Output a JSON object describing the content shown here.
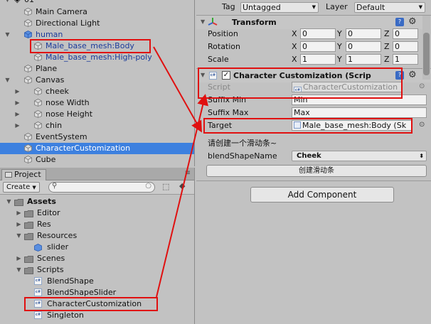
{
  "hierarchy": {
    "partial_label": "01",
    "rows": [
      {
        "label": "Main Camera",
        "indent": 1,
        "expand": "",
        "selected": false,
        "blue": false
      },
      {
        "label": "Directional Light",
        "indent": 1,
        "expand": "",
        "selected": false,
        "blue": false
      },
      {
        "label": "human",
        "indent": 1,
        "expand": "down",
        "selected": false,
        "blue": true
      },
      {
        "label": "Male_base_mesh:Body",
        "indent": 2,
        "expand": "",
        "selected": false,
        "blue": true
      },
      {
        "label": "Male_base_mesh:High-poly",
        "indent": 2,
        "expand": "",
        "selected": false,
        "blue": true
      },
      {
        "label": "Plane",
        "indent": 1,
        "expand": "",
        "selected": false,
        "blue": false
      },
      {
        "label": "Canvas",
        "indent": 1,
        "expand": "down",
        "selected": false,
        "blue": false
      },
      {
        "label": "cheek",
        "indent": 2,
        "expand": "right",
        "selected": false,
        "blue": false
      },
      {
        "label": "nose Width",
        "indent": 2,
        "expand": "right",
        "selected": false,
        "blue": false
      },
      {
        "label": "nose Height",
        "indent": 2,
        "expand": "right",
        "selected": false,
        "blue": false
      },
      {
        "label": "chin",
        "indent": 2,
        "expand": "right",
        "selected": false,
        "blue": false
      },
      {
        "label": "EventSystem",
        "indent": 1,
        "expand": "",
        "selected": false,
        "blue": false
      },
      {
        "label": "CharacterCustomization",
        "indent": 1,
        "expand": "",
        "selected": true,
        "blue": false
      },
      {
        "label": "Cube",
        "indent": 1,
        "expand": "",
        "selected": false,
        "blue": false
      }
    ]
  },
  "project": {
    "tab_label": "Project",
    "create_label": "Create",
    "rows": [
      {
        "label": "Assets",
        "type": "folder",
        "indent": 0,
        "expand": "down",
        "bold": true
      },
      {
        "label": "Editor",
        "type": "folder",
        "indent": 1,
        "expand": "right",
        "bold": false
      },
      {
        "label": "Res",
        "type": "folder",
        "indent": 1,
        "expand": "right",
        "bold": false
      },
      {
        "label": "Resources",
        "type": "folder",
        "indent": 1,
        "expand": "down",
        "bold": false
      },
      {
        "label": "slider",
        "type": "prefab",
        "indent": 2,
        "expand": "",
        "bold": false
      },
      {
        "label": "Scenes",
        "type": "folder",
        "indent": 1,
        "expand": "right",
        "bold": false
      },
      {
        "label": "Scripts",
        "type": "folder",
        "indent": 1,
        "expand": "down",
        "bold": false
      },
      {
        "label": "BlendShape",
        "type": "script",
        "indent": 2,
        "expand": "",
        "bold": false
      },
      {
        "label": "BlendShapeSlider",
        "type": "script",
        "indent": 2,
        "expand": "",
        "bold": false
      },
      {
        "label": "CharacterCustomization",
        "type": "script",
        "indent": 2,
        "expand": "",
        "bold": false
      },
      {
        "label": "Singleton",
        "type": "script",
        "indent": 2,
        "expand": "",
        "bold": false
      }
    ]
  },
  "inspector": {
    "tag_label": "Tag",
    "tag_value": "Untagged",
    "layer_label": "Layer",
    "layer_value": "Default",
    "transform": {
      "title": "Transform",
      "position_label": "Position",
      "rotation_label": "Rotation",
      "scale_label": "Scale",
      "x": "X",
      "y": "Y",
      "z": "Z",
      "position": [
        "0",
        "0",
        "0"
      ],
      "rotation": [
        "0",
        "0",
        "0"
      ],
      "scale": [
        "1",
        "1",
        "1"
      ]
    },
    "component": {
      "title": "Character Customization (Scrip",
      "cs_icon": "c#",
      "script_label": "Script",
      "script_value": "CharacterCustomization",
      "suffix_min_label": "Suffix Min",
      "suffix_min_value": "Min",
      "suffix_max_label": "Suffix Max",
      "suffix_max_value": "Max",
      "target_label": "Target",
      "target_value": "Male_base_mesh:Body (Sk",
      "create_hint": "请创建一个滑动条~",
      "blend_label": "blendShapeName",
      "blend_value": "Cheek",
      "create_button": "创建滑动条"
    },
    "add_component": "Add Component"
  },
  "colors": {
    "selection": "#3d80df",
    "annotation_red": "#e01010"
  }
}
